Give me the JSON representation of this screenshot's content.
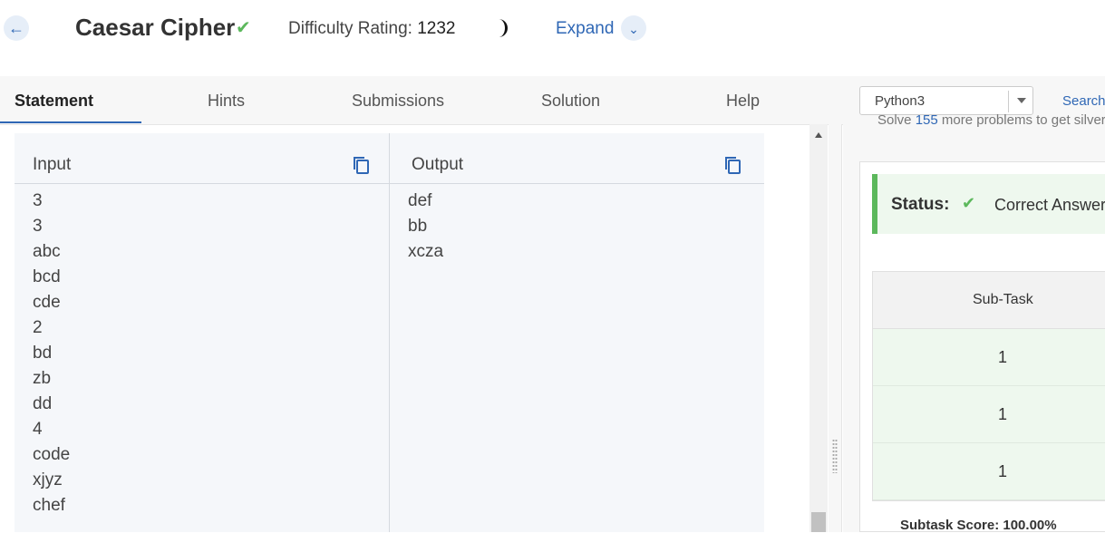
{
  "header": {
    "title": "Caesar Cipher",
    "difficulty_label": "Difficulty Rating:",
    "difficulty_value": "1232",
    "expand_label": "Expand"
  },
  "tabs": [
    "Statement",
    "Hints",
    "Submissions",
    "Solution",
    "Help"
  ],
  "language": {
    "selected": "Python3"
  },
  "search_label": "Search",
  "solve_text": {
    "prefix": "Solve",
    "num": "155",
    "suffix": "more problems to get silver"
  },
  "io": {
    "input_label": "Input",
    "output_label": "Output",
    "input_lines": [
      "3",
      "3",
      "abc",
      "bcd",
      "cde",
      "2",
      "bd",
      "zb",
      "dd",
      "4",
      "code",
      "xjyz",
      "chef"
    ],
    "output_lines": [
      "def",
      "bb",
      "xcza"
    ]
  },
  "status": {
    "label": "Status:",
    "value": "Correct Answer"
  },
  "subtasks": {
    "header": "Sub-Task",
    "rows": [
      "1",
      "1",
      "1"
    ],
    "score": "Subtask Score: 100.00%"
  },
  "colors": {
    "accent": "#2f67b5",
    "success": "#5cb85c"
  }
}
